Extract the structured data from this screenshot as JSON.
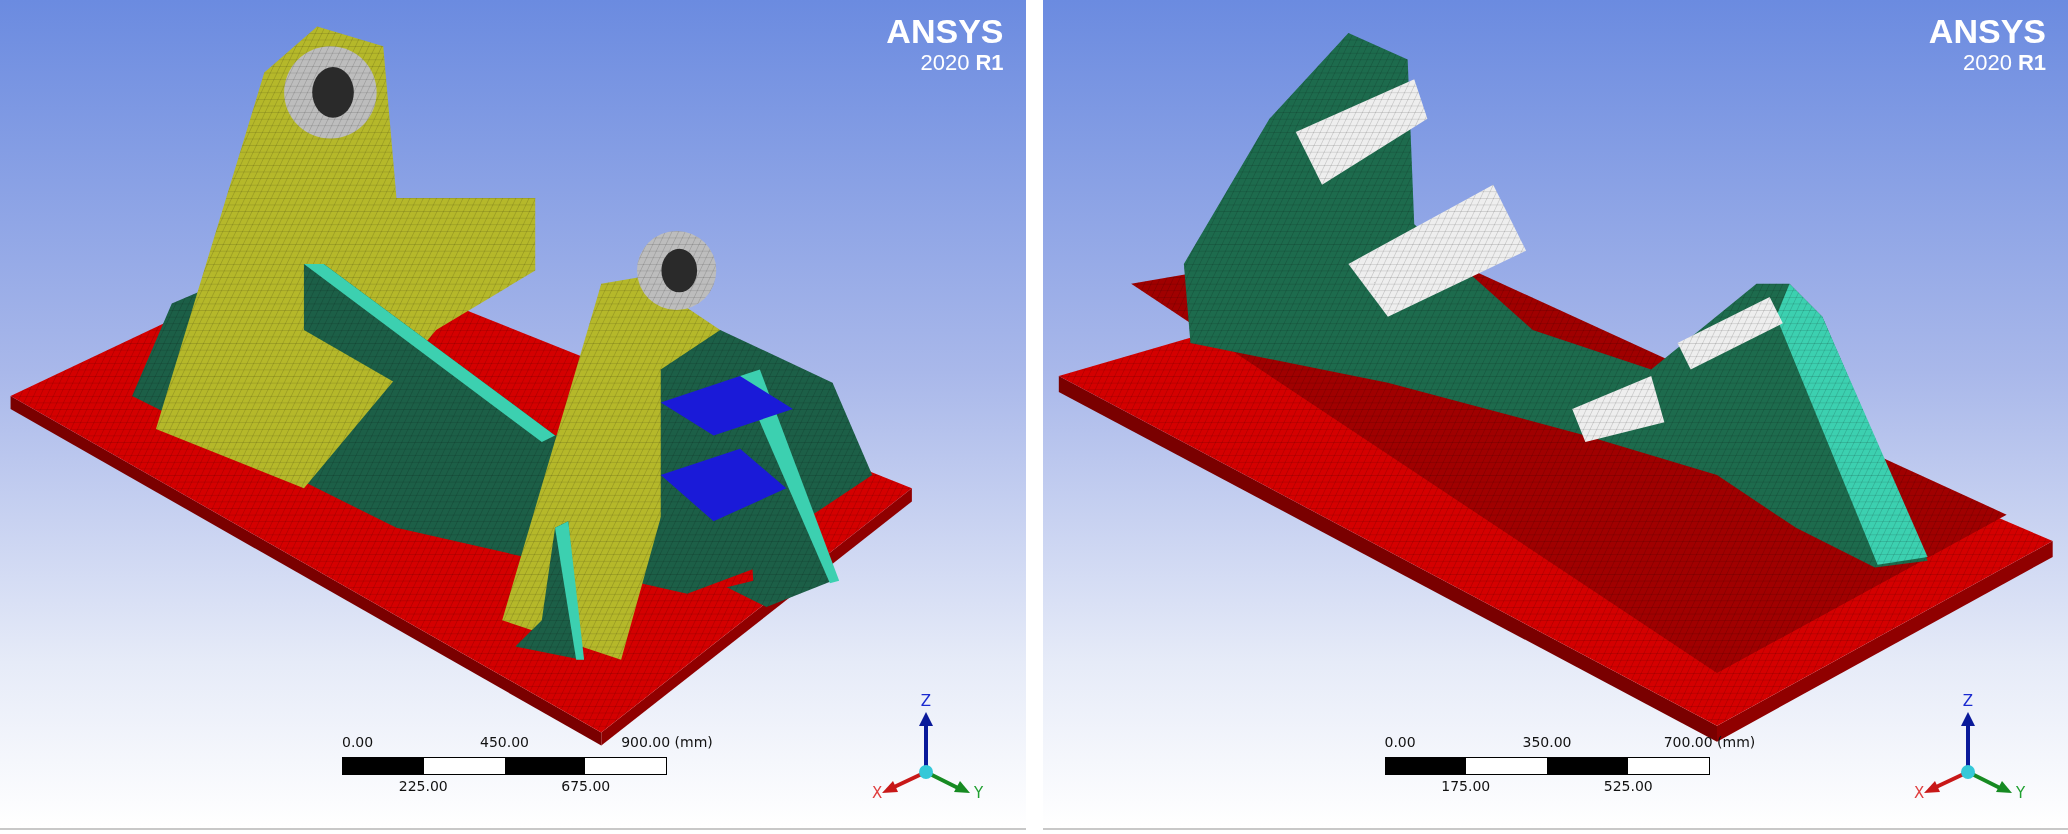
{
  "viewports": [
    {
      "logo": {
        "brand": "ANSYS",
        "version": "2020",
        "release": "R1"
      },
      "scale_bar": {
        "top_labels": [
          "0.00",
          "450.00",
          "900.00 (mm)"
        ],
        "bottom_labels": [
          "225.00",
          "675.00"
        ]
      },
      "triad": {
        "x": "X",
        "y": "Y",
        "z": "Z"
      }
    },
    {
      "logo": {
        "brand": "ANSYS",
        "version": "2020",
        "release": "R1"
      },
      "scale_bar": {
        "top_labels": [
          "0.00",
          "350.00",
          "700.00 (mm)"
        ],
        "bottom_labels": [
          "175.00",
          "525.00"
        ]
      },
      "triad": {
        "x": "X",
        "y": "Y",
        "z": "Z"
      }
    }
  ]
}
